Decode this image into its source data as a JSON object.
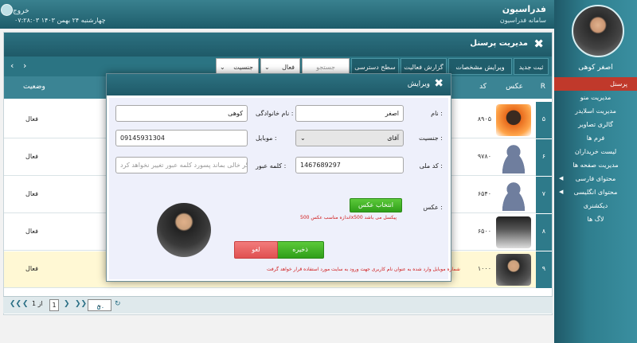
{
  "topbar": {
    "title": "فدراسیون",
    "subtitle": "سامانه فدراسیون",
    "exit": "خروج",
    "date": "چهارشنبه ۲۴ بهمن ۱۴۰۳ ۰۷:۲۸:۰۳"
  },
  "user": {
    "name": "اصغر کوهی"
  },
  "menu": {
    "items": [
      {
        "label": "پرسنل"
      },
      {
        "label": "مدیریت منو"
      },
      {
        "label": "مدیریت اسلایدر"
      },
      {
        "label": "گالری تصاویر"
      },
      {
        "label": "فرم ها"
      },
      {
        "label": "لیست خریداران"
      },
      {
        "label": "مدیریت صفحه ها"
      },
      {
        "label": "محتوای فارسی"
      },
      {
        "label": "محتوای انگلیسی"
      },
      {
        "label": "دیکشنری"
      },
      {
        "label": "لاگ ها"
      }
    ]
  },
  "panel": {
    "title": "مدیریت پرسنل"
  },
  "toolbar": {
    "new": "ثبت جدید",
    "edit": "ویرایش مشخصات",
    "activity": "گزارش فعالیت",
    "access": "سطح دسترسی",
    "search_placeholder": "جستجو",
    "status_value": "فعال",
    "gender_value": "جنسیت"
  },
  "table": {
    "headers": {
      "r": "R",
      "photo": "عکس",
      "code": "کد",
      "status": "وضعیت"
    },
    "rows": [
      {
        "num": "۵",
        "code": "۸۹۰۵",
        "status": "فعال",
        "photo": "person"
      },
      {
        "num": "۶",
        "code": "۹۷۸۰",
        "status": "فعال",
        "photo": "silhouette"
      },
      {
        "num": "۷",
        "code": "۶۵۴۰",
        "status": "فعال",
        "photo": "silhouette"
      },
      {
        "num": "۸",
        "code": "۶۵۰۰",
        "status": "فعال",
        "photo": "person"
      },
      {
        "num": "۹",
        "code": "۱۰۰۰",
        "status": "فعال",
        "photo": "person"
      }
    ]
  },
  "pager": {
    "page": "1",
    "of_label": "از 1",
    "page_size": "۵۰"
  },
  "modal": {
    "title": "ویرایش",
    "first_name_label": "نام :",
    "first_name": "اصغر",
    "last_name_label": "نام خانوادگی :",
    "last_name": "کوهی",
    "gender_label": "جنسیت :",
    "gender": "آقای",
    "mobile_label": "موبایل :",
    "mobile": "09145931304",
    "national_id_label": "کد ملی :",
    "national_id": "1467689297",
    "password_label": "کلمه عبور :",
    "password_placeholder": "اگر خالی بماند پسورد کلمه عبور تغییر نخواهد کرد",
    "photo_label": "عکس :",
    "select_photo": "انتخاب عکس",
    "photo_note": "اندازه مناسب عکس 500x500 پیکسل می باشد",
    "save": "ذخیره",
    "cancel": "لغو",
    "mobile_note": "شماره موبایل وارد شده به عنوان نام کاربری جهت ورود به سایت مورد استفاده قرار خواهد گرفت"
  }
}
